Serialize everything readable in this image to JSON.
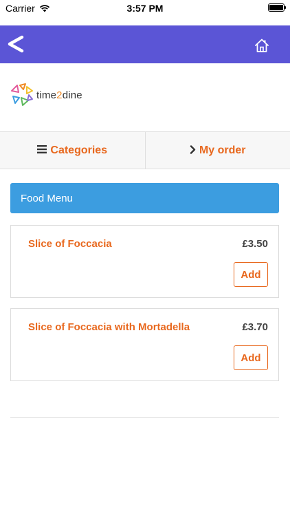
{
  "status_bar": {
    "carrier": "Carrier",
    "time": "3:57 PM"
  },
  "nav": {
    "back_icon": "back-arrow-icon",
    "home_icon": "home-icon",
    "color": "#5b55d6"
  },
  "logo": {
    "part1": "time",
    "part2": "2",
    "part3": "dine"
  },
  "segments": {
    "categories": "Categories",
    "my_order": "My order"
  },
  "menu": {
    "header": "Food Menu",
    "header_color": "#3c9de0",
    "items": [
      {
        "name": "Slice of Foccacia",
        "price": "£3.50",
        "add_label": "Add"
      },
      {
        "name": "Slice of Foccacia with Mortadella",
        "price": "£3.70",
        "add_label": "Add"
      }
    ]
  },
  "accent_color": "#e8681e"
}
